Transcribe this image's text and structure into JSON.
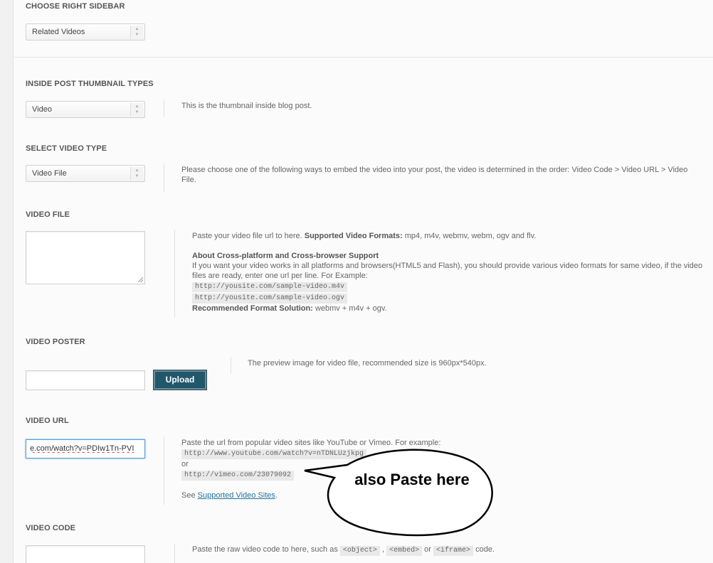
{
  "sections": {
    "right_sidebar": {
      "heading": "CHOOSE RIGHT SIDEBAR",
      "value": "Related Videos"
    },
    "thumbnail_types": {
      "heading": "INSIDE POST THUMBNAIL TYPES",
      "value": "Video",
      "desc": "This is the thumbnail inside blog post."
    },
    "video_type": {
      "heading": "SELECT VIDEO TYPE",
      "value": "Video File",
      "desc": "Please choose one of the following ways to embed the video into your post, the video is determined in the order: Video Code > Video URL > Video File."
    },
    "video_file": {
      "heading": "VIDEO FILE",
      "line1_a": "Paste your video file url to here. ",
      "line1_b": "Supported Video Formats:",
      "line1_c": " mp4, m4v, webmv, webm, ogv and flv.",
      "support_title": "About Cross-platform and Cross-browser Support",
      "support_text": "If you want your video works in all platforms and browsers(HTML5 and Flash), you should provide various video formats for same video, if the video files are ready, enter one url per line. For Example:",
      "example1": "http://yousite.com/sample-video.m4v",
      "example2": "http://yousite.com/sample-video.ogv",
      "recommended_label": "Recommended Format Solution:",
      "recommended_value": " webmv + m4v + ogv."
    },
    "video_poster": {
      "heading": "VIDEO POSTER",
      "upload_label": "Upload",
      "desc": "The preview image for video file, recommended size is 960px*540px."
    },
    "video_url": {
      "heading": "VIDEO URL",
      "value": "e.com/watch?v=PDIw1Tn-PVI",
      "desc": "Paste the url from popular video sites like YouTube or Vimeo. For example:",
      "example1": "http://www.youtube.com/watch?v=nTDNLUzjkpg",
      "or": "or",
      "example2": "http://vimeo.com/23079092",
      "see": "See ",
      "link": "Supported Video Sites",
      "period": "."
    },
    "video_code": {
      "heading": "VIDEO CODE",
      "desc_a": "Paste the raw video code to here, such as ",
      "tag1": "<object>",
      "comma": " , ",
      "tag2": "<embed>",
      "or": " or ",
      "tag3": "<iframe>",
      "desc_b": " code."
    }
  },
  "annotation": {
    "text": "also Paste here"
  }
}
